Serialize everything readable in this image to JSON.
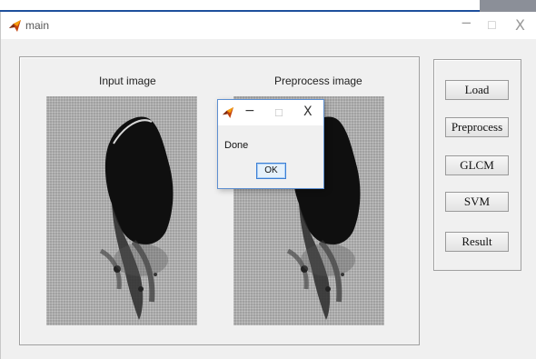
{
  "window": {
    "title": "main",
    "icon": "matlab-icon",
    "controls": {
      "minimize": "−",
      "maximize": "☐",
      "close": "X"
    }
  },
  "panel": {
    "input_label": "Input image",
    "preprocess_label": "Preprocess image"
  },
  "buttons": [
    {
      "label": "Load"
    },
    {
      "label": "Preprocess"
    },
    {
      "label": "GLCM"
    },
    {
      "label": "SVM"
    },
    {
      "label": "Result"
    }
  ],
  "dialog": {
    "icon": "matlab-icon",
    "controls": {
      "minimize": "−",
      "maximize": "☐",
      "close": "X"
    },
    "message": "Done",
    "ok_label": "OK"
  },
  "colors": {
    "accent": "#1e4f9c",
    "ok_border": "#3c7fd4",
    "dialog_border": "#5d8fd0"
  }
}
